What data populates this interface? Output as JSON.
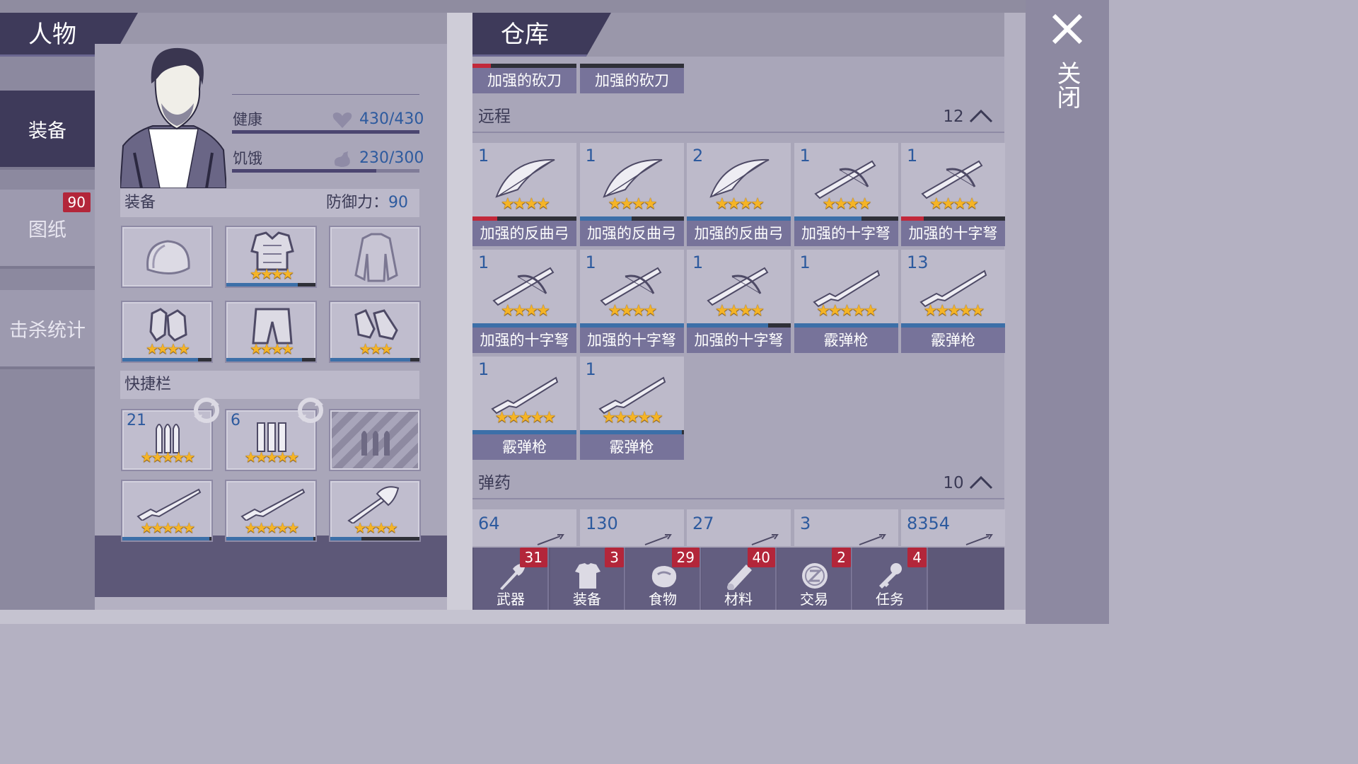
{
  "character": {
    "title": "人物",
    "tabs": [
      {
        "label": "装备",
        "active": true,
        "badge": ""
      },
      {
        "label": "图纸",
        "active": false,
        "badge": "90"
      },
      {
        "label": "击杀统计",
        "active": false,
        "badge": ""
      }
    ],
    "stats": {
      "health_label": "健康",
      "health_value": "430/430",
      "health_fraction": 1.0,
      "hunger_label": "饥饿",
      "hunger_value": "230/300",
      "hunger_fraction": 0.77
    },
    "equipment": {
      "label": "装备",
      "defense_label": "防御力：",
      "defense_value": "90",
      "slots": [
        {
          "icon": "hat-icon",
          "stars": "",
          "bar": 0
        },
        {
          "icon": "armor-vest-icon",
          "stars": "★★★★",
          "bar": 0.8
        },
        {
          "icon": "jacket-icon",
          "stars": "",
          "bar": 0
        },
        {
          "icon": "gloves-icon",
          "stars": "★★★★",
          "bar": 0.85
        },
        {
          "icon": "pants-icon",
          "stars": "★★★★",
          "bar": 0.85
        },
        {
          "icon": "boots-icon",
          "stars": "★★★",
          "bar": 0.9
        }
      ]
    },
    "quickbar": {
      "label": "快捷栏",
      "slots": [
        {
          "icon": "bullets-icon",
          "count": "21",
          "stars": "★★★★★",
          "bar": 0
        },
        {
          "icon": "shotgun-shells-icon",
          "count": "6",
          "stars": "★★★★★",
          "bar": 0
        },
        {
          "icon": "empty-ammo-slot-icon",
          "count": "",
          "stars": "",
          "bar": 0
        },
        {
          "icon": "shotgun-icon",
          "count": "",
          "stars": "★★★★★",
          "bar": 0.98
        },
        {
          "icon": "shotgun-icon",
          "count": "",
          "stars": "★★★★★",
          "bar": 0.98
        },
        {
          "icon": "axe-icon",
          "count": "",
          "stars": "★★★★",
          "bar": 0.35
        }
      ]
    }
  },
  "storage": {
    "title": "仓库",
    "top_items": [
      {
        "label": "加强的砍刀",
        "bar": 0.18,
        "red": true
      },
      {
        "label": "加强的砍刀",
        "bar": 0.0,
        "red": false
      }
    ],
    "ranged": {
      "label": "远程",
      "count": "12",
      "items": [
        {
          "count": "1",
          "label": "加强的反曲弓",
          "icon": "bow-icon",
          "stars": "★★★★",
          "bar": 0.24,
          "red": true
        },
        {
          "count": "1",
          "label": "加强的反曲弓",
          "icon": "bow-icon",
          "stars": "★★★★",
          "bar": 0.5,
          "red": false
        },
        {
          "count": "2",
          "label": "加强的反曲弓",
          "icon": "bow-icon",
          "stars": "★★★★",
          "bar": 1.0,
          "red": false
        },
        {
          "count": "1",
          "label": "加强的十字弩",
          "icon": "crossbow-icon",
          "stars": "★★★★",
          "bar": 0.65,
          "red": false
        },
        {
          "count": "1",
          "label": "加强的十字弩",
          "icon": "crossbow-icon",
          "stars": "★★★★",
          "bar": 0.22,
          "red": true
        },
        {
          "count": "1",
          "label": "加强的十字弩",
          "icon": "crossbow-icon",
          "stars": "★★★★",
          "bar": 1.0,
          "red": false
        },
        {
          "count": "1",
          "label": "加强的十字弩",
          "icon": "crossbow-icon",
          "stars": "★★★★",
          "bar": 1.0,
          "red": false
        },
        {
          "count": "1",
          "label": "加强的十字弩",
          "icon": "crossbow-icon",
          "stars": "★★★★",
          "bar": 0.78,
          "red": false
        },
        {
          "count": "1",
          "label": "霰弹枪",
          "icon": "shotgun-icon",
          "stars": "★★★★★",
          "bar": 1.0,
          "red": false
        },
        {
          "count": "13",
          "label": "霰弹枪",
          "icon": "shotgun-icon",
          "stars": "★★★★★",
          "bar": 1.0,
          "red": false
        },
        {
          "count": "1",
          "label": "霰弹枪",
          "icon": "shotgun-icon",
          "stars": "★★★★★",
          "bar": 1.0,
          "red": false
        },
        {
          "count": "1",
          "label": "霰弹枪",
          "icon": "shotgun-icon",
          "stars": "★★★★★",
          "bar": 0.98,
          "red": false
        }
      ]
    },
    "ammo": {
      "label": "弹药",
      "count": "10",
      "items": [
        {
          "count": "64"
        },
        {
          "count": "130"
        },
        {
          "count": "27"
        },
        {
          "count": "3"
        },
        {
          "count": "8354"
        }
      ]
    },
    "bottom_tabs": [
      {
        "label": "武器",
        "badge": "31",
        "icon": "axe-icon"
      },
      {
        "label": "装备",
        "badge": "3",
        "icon": "shirt-icon"
      },
      {
        "label": "食物",
        "badge": "29",
        "icon": "meat-icon"
      },
      {
        "label": "材料",
        "badge": "40",
        "icon": "log-icon"
      },
      {
        "label": "交易",
        "badge": "2",
        "icon": "coin-icon"
      },
      {
        "label": "任务",
        "badge": "4",
        "icon": "key-icon"
      }
    ]
  },
  "close": {
    "label": "关闭"
  },
  "colors": {
    "accent_blue": "#3c6fa8",
    "badge_red": "#b3263a",
    "star_gold": "#f5b426"
  }
}
